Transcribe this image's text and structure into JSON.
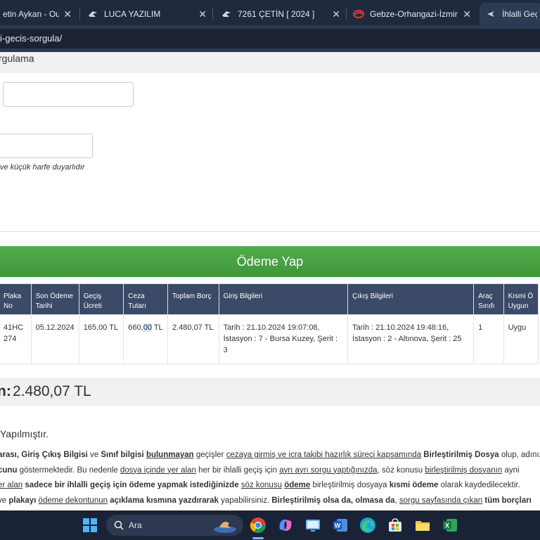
{
  "browser": {
    "tabs": [
      {
        "title": "etin Aykan - Outlo",
        "close": "✕"
      },
      {
        "title": "LUCA YAZILIM",
        "close": "✕"
      },
      {
        "title": "7261 ÇETİN [ 2024 ]",
        "close": "✕"
      },
      {
        "title": "Gebze-Orhangazi-İzmir Ot",
        "close": "✕"
      },
      {
        "title": "İhlalli Geçiş",
        "close": ""
      }
    ],
    "address": "i-gecis-sorgula/"
  },
  "page": {
    "section_title": "rgulama",
    "hint": "ve küçük harfe duyarlıdır",
    "pay_button": "Ödeme Yap",
    "table": {
      "headers": [
        "Plaka No",
        "Son Ödeme Tarihi",
        "Geçiş Ücreti",
        "Ceza Tutarı",
        "Toplam Borç",
        "Giriş Bilgileri",
        "Çıkış Bilgileri",
        "Araç Sınıfı",
        "Kısmi Ö Uygun"
      ],
      "row": {
        "plate": "41HC 274",
        "due_date": "05.12.2024",
        "toll": "165,00 TL",
        "fine_a": "660,",
        "fine_b": "00",
        "fine_c": " TL",
        "total": "2.480,07 TL",
        "entry": "Tarih : 21.10.2024 19:07:08, İstasyon : 7 - Bursa Kuzey, Şerit : 3",
        "exit": "Tarih : 21.10.2024 19:48:16, İstasyon : 2 - Altınova, Şerit : 25",
        "class": "1",
        "partial": "Uygu"
      }
    },
    "total_label": "n:",
    "total_value": "2.480,07 TL",
    "paid_text": "Yapılmıştır.",
    "para": {
      "l1_a": "arası, ",
      "l1_b": "Giriş Çıkış Bilgisi",
      "l1_c": " ve ",
      "l1_d": "Sınıf bilgisi",
      "l1_e": " ",
      "l1_f": "bulunmayan",
      "l1_g": " geçişler ",
      "l1_h": "cezaya girmiş ve icra takibi hazırlık süreci kapsamında",
      "l1_i": " ",
      "l1_j": "Birleştirilmiş Dosya",
      "l1_k": " olup, adınız",
      "l2_a": "cunu",
      "l2_b": " göstermektedir. Bu nedenle ",
      "l2_c": "dosya içinde yer alan",
      "l2_d": " her bir ihlalli geçiş için ",
      "l2_e": "ayrı ayrı sorgu yaptığınızda",
      "l2_f": ", söz konusu ",
      "l2_g": "birleştirilmiş dosyanın",
      "l2_h": " ayni",
      "l3_a": "er alan",
      "l3_b": " sadece bir ihlalli geçiş için ödeme yapmak istediğinizde",
      "l3_c": " ",
      "l3_d": "söz konusu",
      "l3_e": " ",
      "l3_f": "ödeme",
      "l3_g": " birleştirilmiş dosyaya ",
      "l3_h": "kısmi ödeme",
      "l3_i": " olarak kaydedilecektir.",
      "l4_a": "ve ",
      "l4_b": "plakayı",
      "l4_c": " ",
      "l4_d": "ödeme dekontunun",
      "l4_e": " ",
      "l4_f": "açıklama kısmına yazdırarak",
      "l4_g": " yapabilirsiniz. ",
      "l4_h": "Birleştirilmiş olsa da, olmasa da",
      "l4_i": ", ",
      "l4_j": "sorgu sayfasında çıkan",
      "l4_k": " ",
      "l4_l": "tüm borçları"
    }
  },
  "taskbar": {
    "search_placeholder": "Ara"
  }
}
